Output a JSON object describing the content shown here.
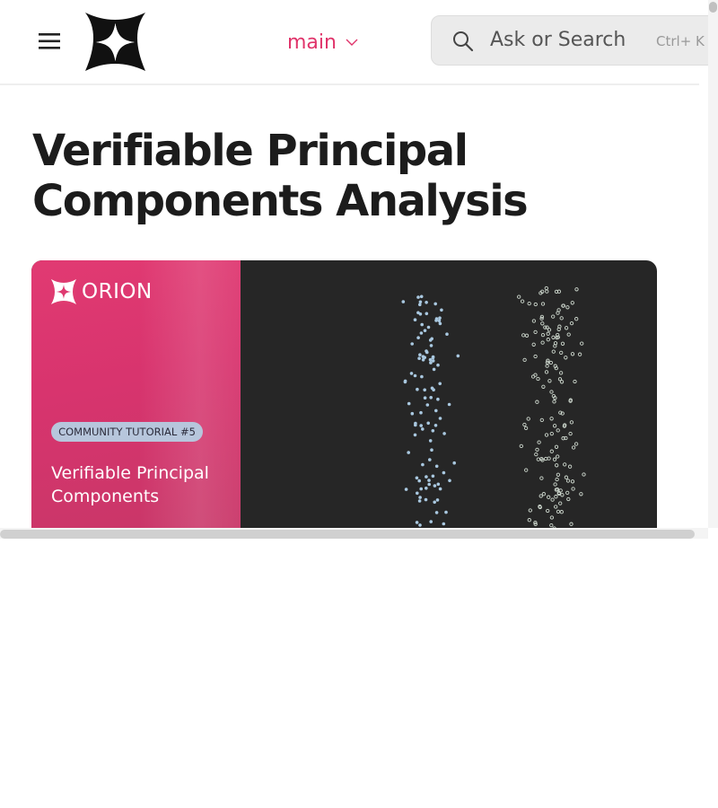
{
  "header": {
    "branch_label": "main",
    "search_placeholder": "Ask or Search",
    "search_shortcut": "Ctrl+ K"
  },
  "page": {
    "title": "Verifiable Principal Components Analysis"
  },
  "cover_image": {
    "brand_name": "ORION",
    "badge": "COMMUNITY TUTORIAL #5",
    "title_lines": "Verifiable Principal Components",
    "colors": {
      "panel": "#e0336a",
      "background": "#262626",
      "badge": "#b7c6dc",
      "points_filled": "#a9c8e0",
      "points_hollow": "#cfd9cf"
    }
  },
  "colors": {
    "accent": "#e0336a",
    "title": "#1c1c1c",
    "search_bg": "#ebebeb"
  }
}
